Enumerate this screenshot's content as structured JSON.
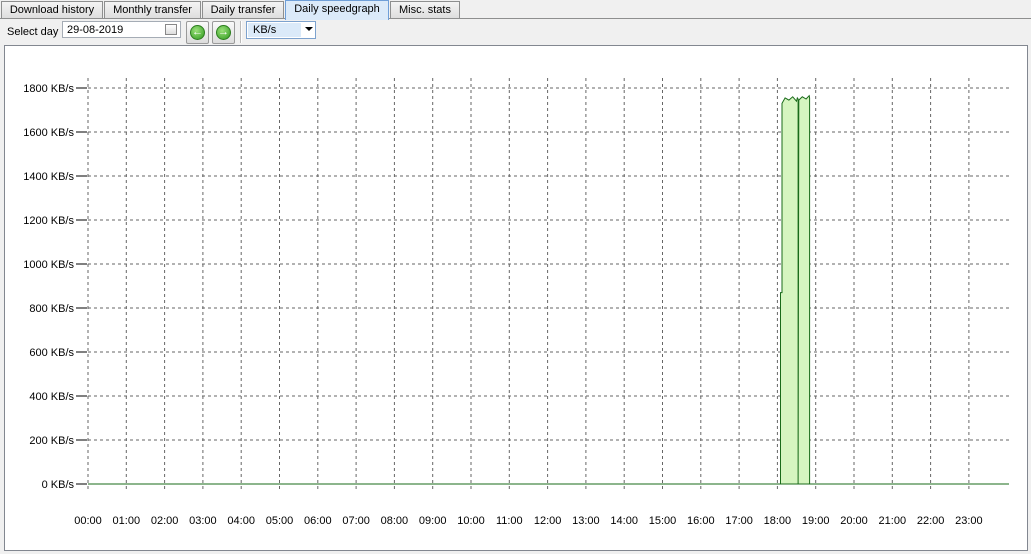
{
  "tabs": [
    {
      "label": "Download history",
      "active": false
    },
    {
      "label": "Monthly transfer",
      "active": false
    },
    {
      "label": "Daily transfer",
      "active": false
    },
    {
      "label": "Daily speedgraph",
      "active": true
    },
    {
      "label": "Misc. stats",
      "active": false
    }
  ],
  "toolbar": {
    "select_day_label": "Select day",
    "date_value": "29-08-2019",
    "prev_icon": "arrow-left-icon",
    "next_icon": "arrow-right-icon",
    "unit_selected": "KB/s"
  },
  "chart_data": {
    "type": "area",
    "x_tick_labels": [
      "00:00",
      "01:00",
      "02:00",
      "03:00",
      "04:00",
      "05:00",
      "06:00",
      "07:00",
      "08:00",
      "09:00",
      "10:00",
      "11:00",
      "12:00",
      "13:00",
      "14:00",
      "15:00",
      "16:00",
      "17:00",
      "18:00",
      "19:00",
      "20:00",
      "21:00",
      "22:00",
      "23:00"
    ],
    "y_ticks": [
      0,
      200,
      400,
      600,
      800,
      1000,
      1200,
      1400,
      1600,
      1800
    ],
    "y_tick_labels": [
      "0 KB/s",
      "200 KB/s",
      "400 KB/s",
      "600 KB/s",
      "800 KB/s",
      "1000 KB/s",
      "1200 KB/s",
      "1400 KB/s",
      "1600 KB/s",
      "1800 KB/s"
    ],
    "ylim": [
      0,
      1800
    ],
    "xlim_hours": [
      0,
      23.4
    ],
    "grid": true,
    "series": [
      {
        "color": "#1a6b1a",
        "fill": "#d6f5c0",
        "x_hours": [
          0,
          18.08,
          18.08,
          18.12,
          18.12,
          18.2,
          18.3,
          18.4,
          18.5,
          18.52,
          18.54,
          18.54,
          18.56,
          18.65,
          18.75,
          18.83,
          18.84,
          18.84,
          18.84,
          23.4
        ],
        "values": [
          0,
          0,
          870,
          870,
          1730,
          1755,
          1745,
          1760,
          1740,
          1755,
          1750,
          0,
          1745,
          1760,
          1750,
          1765,
          1755,
          0,
          0,
          0
        ]
      }
    ],
    "line_color": "#1a6b1a",
    "fill_color": "#d6f5c0"
  }
}
